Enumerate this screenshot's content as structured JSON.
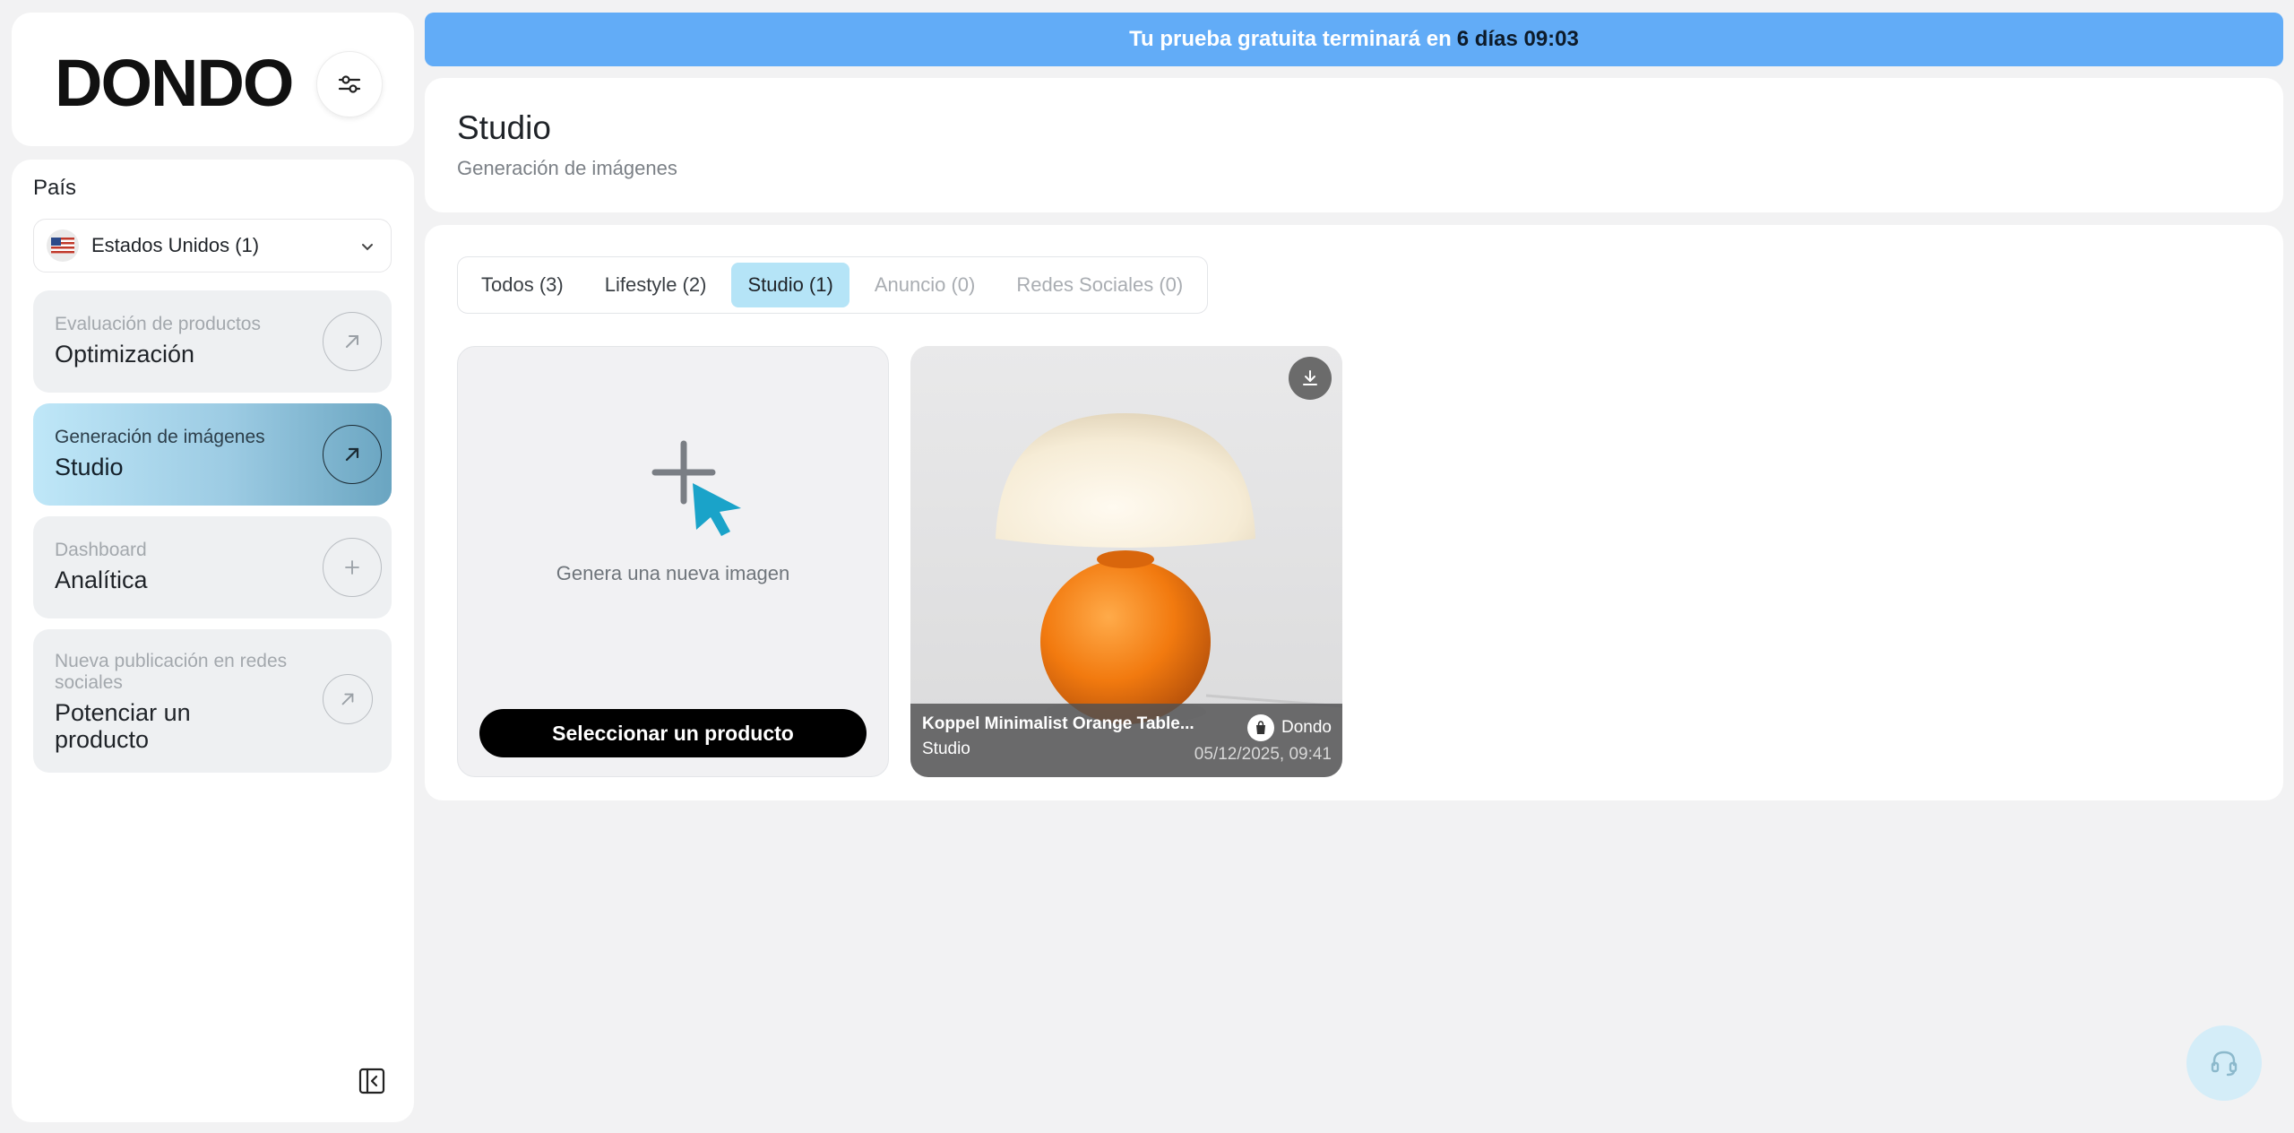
{
  "brand": {
    "logo_text": "DONDO"
  },
  "sidebar": {
    "country_label": "País",
    "country_value": "Estados Unidos (1)",
    "items": [
      {
        "sub": "Evaluación de productos",
        "title": "Optimización"
      },
      {
        "sub": "Generación de imágenes",
        "title": "Studio"
      },
      {
        "sub": "Dashboard",
        "title": "Analítica"
      },
      {
        "sub": "Nueva publicación en redes sociales",
        "title": "Potenciar un producto"
      }
    ]
  },
  "banner": {
    "text": "Tu prueba gratuita terminará en",
    "highlight": "6 días 09:03"
  },
  "header": {
    "title": "Studio",
    "subtitle": "Generación de imágenes"
  },
  "tabs": [
    {
      "label": "Todos (3)"
    },
    {
      "label": "Lifestyle (2)"
    },
    {
      "label": "Studio (1)"
    },
    {
      "label": "Anuncio (0)"
    },
    {
      "label": "Redes Sociales (0)"
    }
  ],
  "new_card": {
    "text": "Genera una nueva imagen",
    "button": "Seleccionar un producto"
  },
  "image_card": {
    "title": "Koppel Minimalist Orange Table...",
    "type": "Studio",
    "brand": "Dondo",
    "date": "05/12/2025, 09:41"
  },
  "colors": {
    "accent": "#62acf7",
    "active_tab": "#b5e4f7",
    "cursor": "#1aa3c9"
  }
}
